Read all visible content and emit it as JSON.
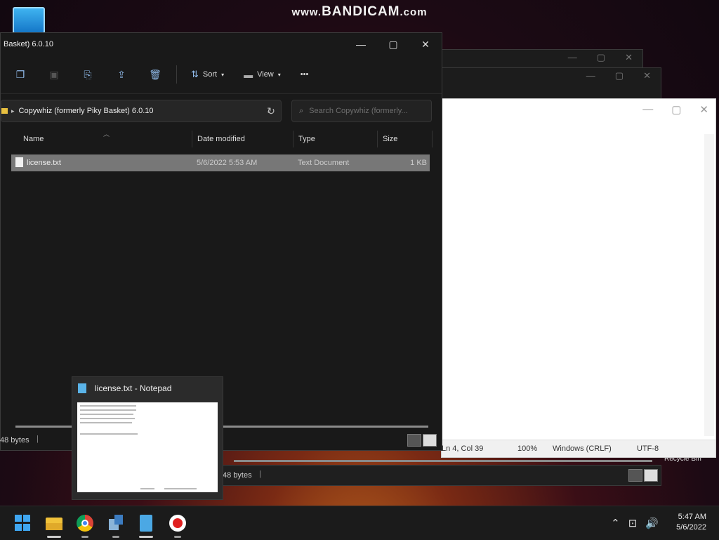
{
  "watermark": {
    "prefix": "www.",
    "brand": "BANDICAM",
    "suffix": ".com"
  },
  "desktop": {
    "recycle_bin_label": "Recycle Bin"
  },
  "explorer": {
    "title": "Basket) 6.0.10",
    "window_controls": {
      "minimize": "—",
      "maximize": "▢",
      "close": "✕"
    },
    "toolbar": {
      "icons": [
        {
          "name": "copy-icon",
          "glyph": "❐"
        },
        {
          "name": "paste-icon",
          "glyph": "▣"
        },
        {
          "name": "rename-icon",
          "glyph": "⎘"
        },
        {
          "name": "share-icon",
          "glyph": "⇪"
        },
        {
          "name": "delete-icon",
          "glyph": "🗑"
        }
      ],
      "sort_label": "Sort",
      "view_label": "View",
      "more_label": "•••"
    },
    "address": {
      "path": "Copywhiz (formerly Piky Basket) 6.0.10",
      "search_placeholder": "Search Copywhiz (formerly..."
    },
    "columns": {
      "name": "Name",
      "date_modified": "Date modified",
      "type": "Type",
      "size": "Size"
    },
    "files": [
      {
        "name": "license.txt",
        "date_modified": "5/6/2022 5:53 AM",
        "type": "Text Document",
        "size": "1 KB"
      }
    ],
    "status_text": "48 bytes"
  },
  "lower_window": {
    "status_text": "48 bytes"
  },
  "notepad": {
    "controls": {
      "minimize": "—",
      "maximize": "▢",
      "close": "✕"
    },
    "status": {
      "position": "Ln 4, Col 39",
      "zoom": "100%",
      "line_ending": "Windows (CRLF)",
      "encoding": "UTF-8"
    }
  },
  "thumbnail": {
    "title": "license.txt - Notepad"
  },
  "taskbar": {
    "clock_time": "5:47 AM",
    "clock_date": "5/6/2022",
    "tray": {
      "chevron": "⌃",
      "network": "⊡",
      "volume": "🔊"
    }
  }
}
